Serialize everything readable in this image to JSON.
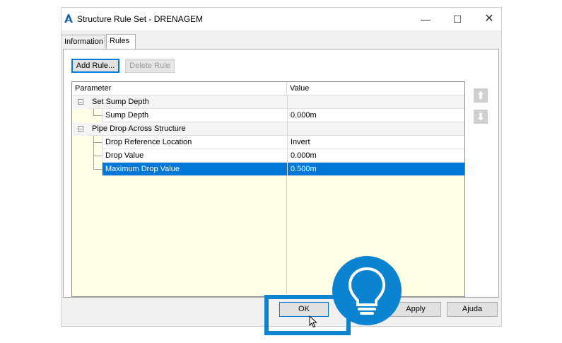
{
  "window": {
    "title": "Structure Rule Set - DRENAGEM",
    "minimize_glyph": "—",
    "maximize_glyph": "☐",
    "close_glyph": "✕"
  },
  "tabs": [
    {
      "label": "Information"
    },
    {
      "label": "Rules"
    }
  ],
  "toolbar": {
    "add_rule_label": "Add Rule...",
    "delete_rule_label": "Delete Rule"
  },
  "grid": {
    "headers": {
      "parameter": "Parameter",
      "value": "Value"
    },
    "rows": [
      {
        "name": "Set Sump Depth",
        "value": ""
      },
      {
        "name": "Sump Depth",
        "value": "0.000m"
      },
      {
        "name": "Pipe Drop Across Structure",
        "value": ""
      },
      {
        "name": "Drop Reference Location",
        "value": "Invert"
      },
      {
        "name": "Drop Value",
        "value": "0.000m"
      },
      {
        "name": "Maximum Drop Value",
        "value": "0.500m"
      }
    ]
  },
  "side_buttons": {
    "up_glyph": "⬆",
    "down_glyph": "⬇"
  },
  "footer": {
    "ok_label": "OK",
    "apply_label": "Apply",
    "help_label": "Ajuda"
  },
  "icons": {
    "app": "autocad-app-icon",
    "overlay": "lightbulb-icon",
    "cursor": "mouse-pointer-icon"
  },
  "colors": {
    "accent": "#0078d7",
    "overlay_blue": "#0a84d0",
    "grid_background": "#ffffe6"
  }
}
